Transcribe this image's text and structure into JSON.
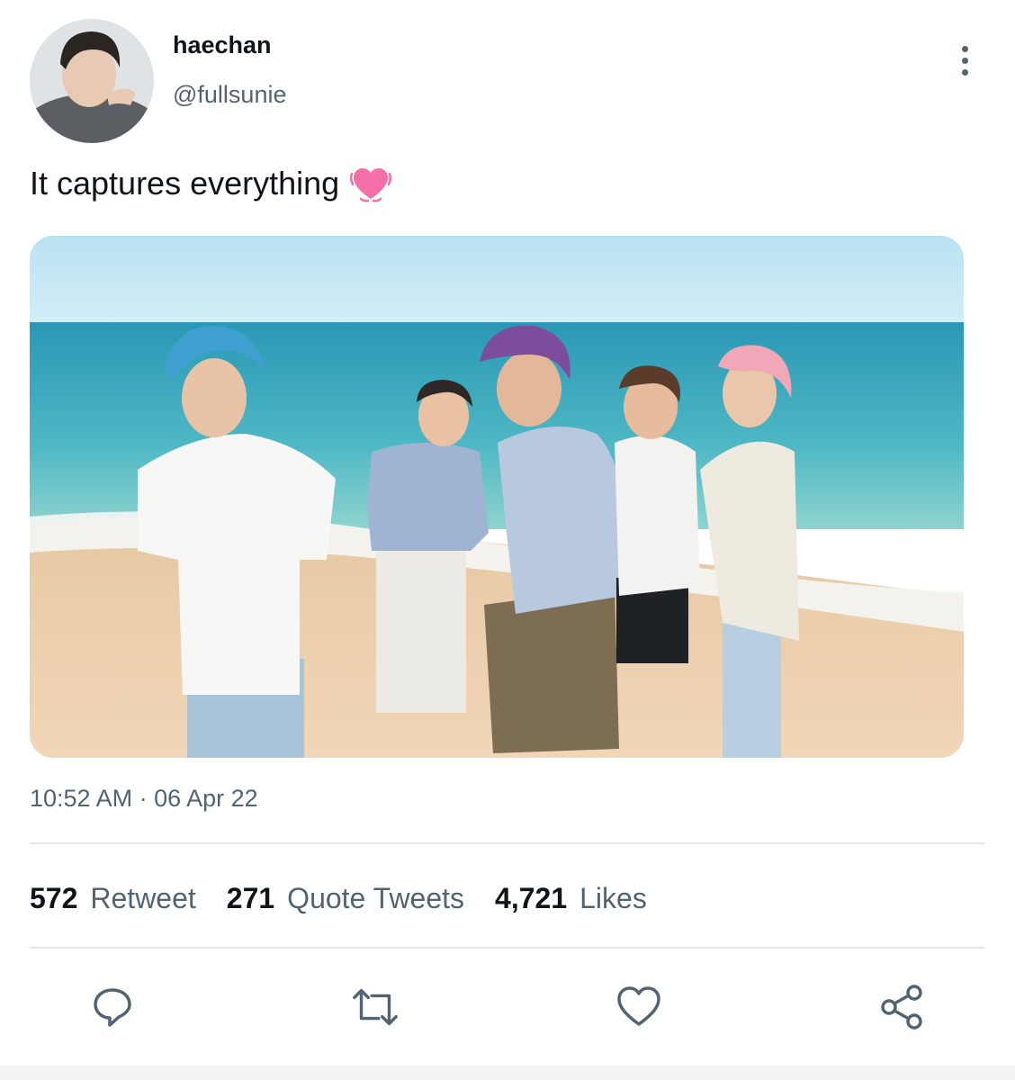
{
  "author": {
    "display_name": "haechan",
    "handle": "@fullsunie"
  },
  "tweet": {
    "text": "It captures everything",
    "emoji": "💓",
    "emoji_icon": "beating-heart-icon",
    "timestamp": "10:52 AM · 06 Apr 22"
  },
  "stats": {
    "retweets_count": "572",
    "retweets_label": "Retweet",
    "quotes_count": "271",
    "quotes_label": "Quote Tweets",
    "likes_count": "4,721",
    "likes_label": "Likes"
  },
  "actions": [
    {
      "name": "reply",
      "icon": "reply-icon"
    },
    {
      "name": "retweet",
      "icon": "retweet-icon"
    },
    {
      "name": "like",
      "icon": "heart-icon"
    },
    {
      "name": "share",
      "icon": "share-icon"
    }
  ],
  "menu_icon": "more-vertical-icon",
  "colors": {
    "primary_text": "#0f1419",
    "secondary_text": "#536471",
    "divider": "#e3e6e8",
    "icon": "#536471"
  }
}
